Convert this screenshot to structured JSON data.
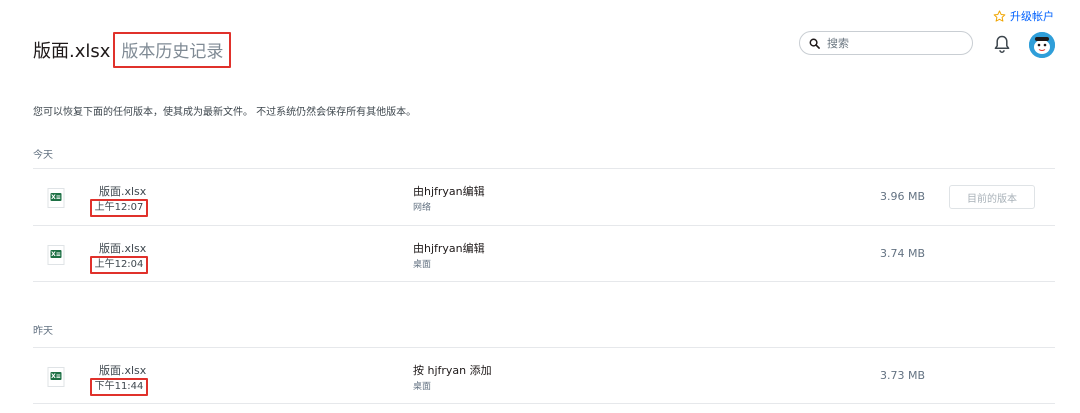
{
  "header": {
    "upgrade_label": "升级帐户",
    "file_title": "版面.xlsx",
    "history_title": "版本历史记录",
    "search_placeholder": "搜索"
  },
  "description": "您可以恢复下面的任何版本，使其成为最新文件。 不过系统仍然会保存所有其他版本。",
  "sections": [
    {
      "label": "今天",
      "versions": [
        {
          "filename": "版面.xlsx",
          "time": "上午12:07",
          "editor": "由hjfryan编辑",
          "source": "网络",
          "size": "3.96 MB",
          "button": "目前的版本"
        },
        {
          "filename": "版面.xlsx",
          "time": "上午12:04",
          "editor": "由hjfryan编辑",
          "source": "桌面",
          "size": "3.74 MB"
        }
      ]
    },
    {
      "label": "昨天",
      "versions": [
        {
          "filename": "版面.xlsx",
          "time": "下午11:44",
          "editor": "按 hjfryan 添加",
          "source": "桌面",
          "size": "3.73 MB"
        }
      ]
    }
  ],
  "colors": {
    "accent": "#0061fe",
    "highlight_box": "#e0312b",
    "excel_green": "#1d7044"
  }
}
